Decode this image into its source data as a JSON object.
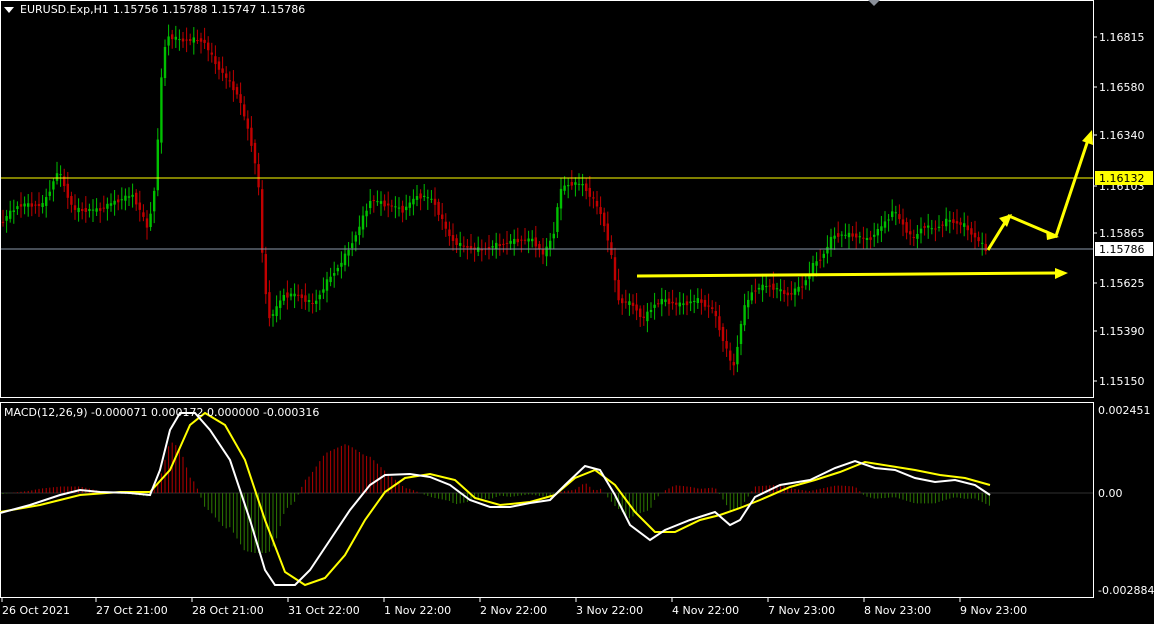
{
  "header": {
    "symbol_tf": "EURUSD.Exp,H1",
    "ohlc": "1.15756 1.15788 1.15747 1.15786"
  },
  "macd": {
    "label": "MACD(12,26,9) -0.000071 0.000172 0.000000 -0.000316",
    "axis_ticks": [
      "0.002451",
      "0.00",
      "-0.002884"
    ]
  },
  "price_axis": {
    "ticks": [
      "1.16815",
      "1.16580",
      "1.16340",
      "1.16103",
      "1.15865",
      "1.15625",
      "1.15390",
      "1.15150"
    ],
    "marker_high": "1.16132",
    "marker_current": "1.15786"
  },
  "time_axis": {
    "labels": [
      "26 Oct 2021",
      "27 Oct 21:00",
      "28 Oct 21:00",
      "31 Oct 22:00",
      "1 Nov 22:00",
      "2 Nov 22:00",
      "3 Nov 22:00",
      "4 Nov 22:00",
      "7 Nov 23:00",
      "8 Nov 23:00",
      "9 Nov 23:00"
    ]
  },
  "colors": {
    "background": "#000000",
    "bull": "#00c000",
    "bear": "#c00000",
    "resistance_line": "#ffff00",
    "current_line": "#8c9aad",
    "annotation": "#ffff00",
    "macd_line": "#ffffff",
    "signal_line": "#ffff00",
    "hist_pos": "#b30000",
    "hist_neg": "#2d7a00"
  }
}
